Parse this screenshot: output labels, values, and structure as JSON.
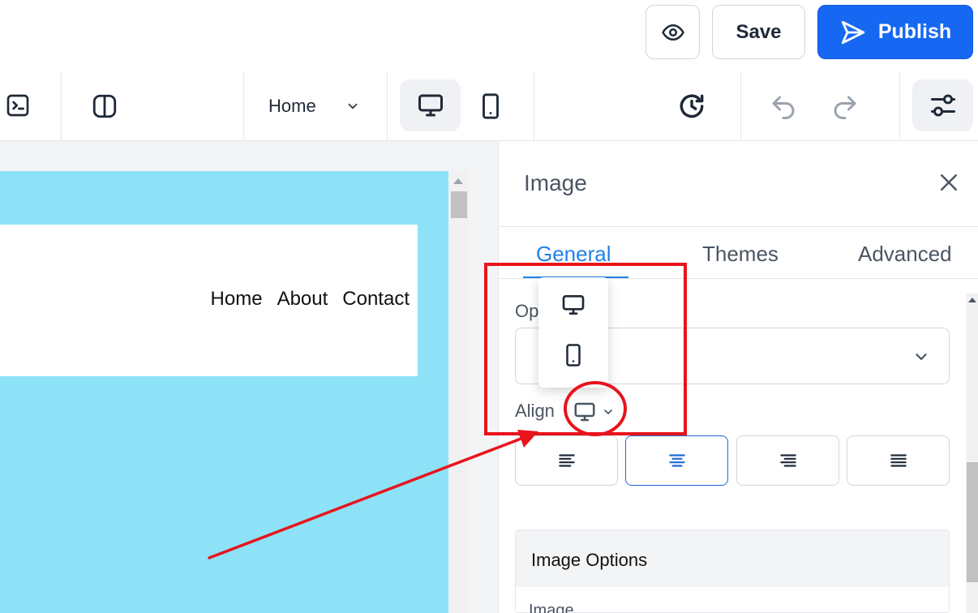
{
  "header": {
    "save_label": "Save",
    "publish_label": "Publish"
  },
  "toolbar": {
    "page_select_value": "Home"
  },
  "canvas": {
    "nav_items": [
      "Home",
      "About",
      "Contact"
    ],
    "colors": {
      "page_bg": "#8de2f8",
      "header_bg": "#ffffff"
    }
  },
  "panel": {
    "title": "Image",
    "tabs": [
      {
        "label": "General",
        "active": true
      },
      {
        "label": "Themes",
        "active": false
      },
      {
        "label": "Advanced",
        "active": false
      }
    ],
    "field_label_partial": "Op",
    "align_label": "Align",
    "align_options": [
      "align-left",
      "align-center",
      "align-right",
      "align-justify"
    ],
    "align_selected": "align-center",
    "image_options_title": "Image Options",
    "image_options_sub": "Image"
  },
  "device_dropdown": {
    "options": [
      "desktop",
      "mobile"
    ]
  },
  "colors": {
    "accent": "#1f82e5",
    "publish": "#1668f2",
    "annotation": "#e8141c"
  }
}
